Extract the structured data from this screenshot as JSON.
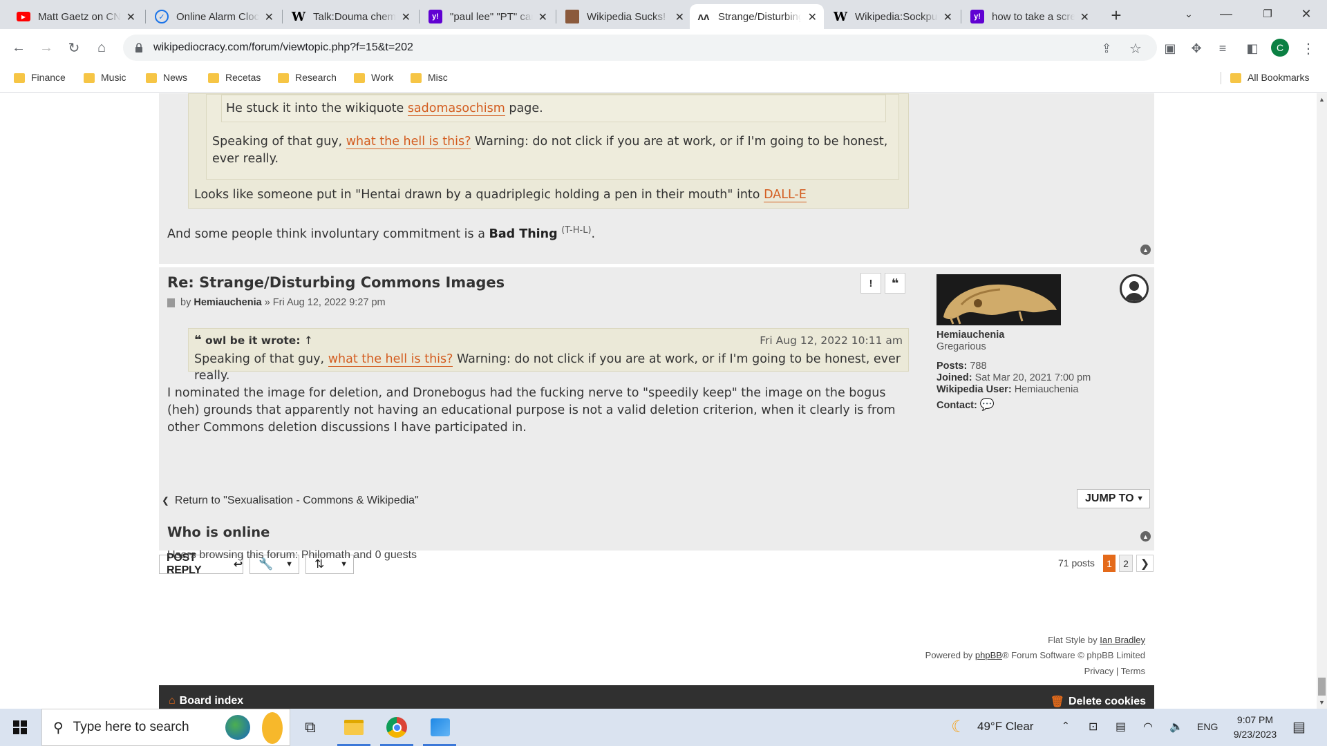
{
  "browser": {
    "tabs": [
      {
        "title": "Matt Gaetz on CNN",
        "icon": "youtube-icon",
        "color": "#ff0000"
      },
      {
        "title": "Online Alarm Clock",
        "icon": "clock-icon",
        "color": "#1a73e8"
      },
      {
        "title": "Talk:Douma chemical attack",
        "icon": "wikipedia-icon",
        "color": "#000000"
      },
      {
        "title": "\"paul lee\" \"PT\" carroll",
        "icon": "yahoo-icon",
        "color": "#6001d2"
      },
      {
        "title": "Wikipedia Sucks!",
        "icon": "image-favicon",
        "color": "#8b5a3c"
      },
      {
        "title": "Strange/Disturbing Commons",
        "icon": "wikipediocracy-icon",
        "color": "#333333"
      },
      {
        "title": "Wikipedia:Sockpuppet",
        "icon": "wikipedia-icon",
        "color": "#000000"
      },
      {
        "title": "how to take a screenshot",
        "icon": "yahoo-icon",
        "color": "#6001d2"
      }
    ],
    "url": "wikipediocracy.com/forum/viewtopic.php?f=15&t=202",
    "avatar_letter": "C",
    "bookmarks": [
      "Finance",
      "Music",
      "News",
      "Recetas",
      "Research",
      "Work",
      "Misc"
    ],
    "all_bookmarks": "All Bookmarks"
  },
  "post1": {
    "inner_quote": {
      "before": "He stuck it into the wikiquote ",
      "link": "sadomasochism",
      "after": " page."
    },
    "mid_quote": {
      "before": "Speaking of that guy, ",
      "link": "what the hell is this?",
      "after": " Warning: do not click if you are at work, or if I'm going to be honest, ever really."
    },
    "outer_quote": {
      "before": "Looks like someone put in \"Hentai drawn by a quadriplegic holding a pen in their mouth\" into ",
      "link": "DALL-E"
    },
    "text_before": "And some people think involuntary commitment is a ",
    "bold": "Bad Thing",
    "sup": "(T-H-L)",
    "text_after": "."
  },
  "post2": {
    "title": "Re: Strange/Disturbing Commons Images",
    "by": "by",
    "author": "Hemiauchenia",
    "date": "» Fri Aug 12, 2022 9:27 pm",
    "quote": {
      "author": "owl be it wrote:",
      "arrow": "↑",
      "date": "Fri Aug 12, 2022 10:11 am",
      "before": "Speaking of that guy, ",
      "link": "what the hell is this?",
      "after": " Warning: do not click if you are at work, or if I'm going to be honest, ever really."
    },
    "body": "I nominated the image for deletion, and Dronebogus had the fucking nerve to \"speedily keep\" the image on the bogus (heh) grounds that apparently not having an educational purpose is not a valid deletion criterion, when it clearly is from other Commons deletion discussions I have participated in.",
    "profile": {
      "name": "Hemiauchenia",
      "rank": "Gregarious",
      "posts_label": "Posts:",
      "posts": "788",
      "joined_label": "Joined:",
      "joined": "Sat Mar 20, 2021 7:00 pm",
      "wp_label": "Wikipedia User:",
      "wp_user": "Hemiauchenia",
      "contact_label": "Contact:"
    }
  },
  "actions": {
    "post_reply": "POST REPLY",
    "posts_count": "71 posts",
    "pages": [
      "1",
      "2"
    ],
    "jump_to": "JUMP TO",
    "return_link": "Return to \"Sexualisation - Commons & Wikipedia\""
  },
  "online": {
    "heading": "Who is online",
    "text": "Users browsing this forum: Philomath and 0 guests"
  },
  "footer": {
    "board_index": "Board index",
    "delete_cookies": "Delete cookies",
    "flat_style": "Flat Style by ",
    "ian": "Ian Bradley",
    "powered": "Powered by ",
    "phpbb": "phpBB",
    "powered_after": "® Forum Software © phpBB Limited",
    "privacy": "Privacy",
    "sep": " | ",
    "terms": "Terms"
  },
  "taskbar": {
    "search_placeholder": "Type here to search",
    "weather": "49°F  Clear",
    "lang": "ENG",
    "time": "9:07 PM",
    "date": "9/23/2023"
  },
  "colors": {
    "link": "#d35c1f",
    "quote_bg": "#ebe9d8",
    "post_bg": "#ececec",
    "footer_bg": "#303030"
  }
}
